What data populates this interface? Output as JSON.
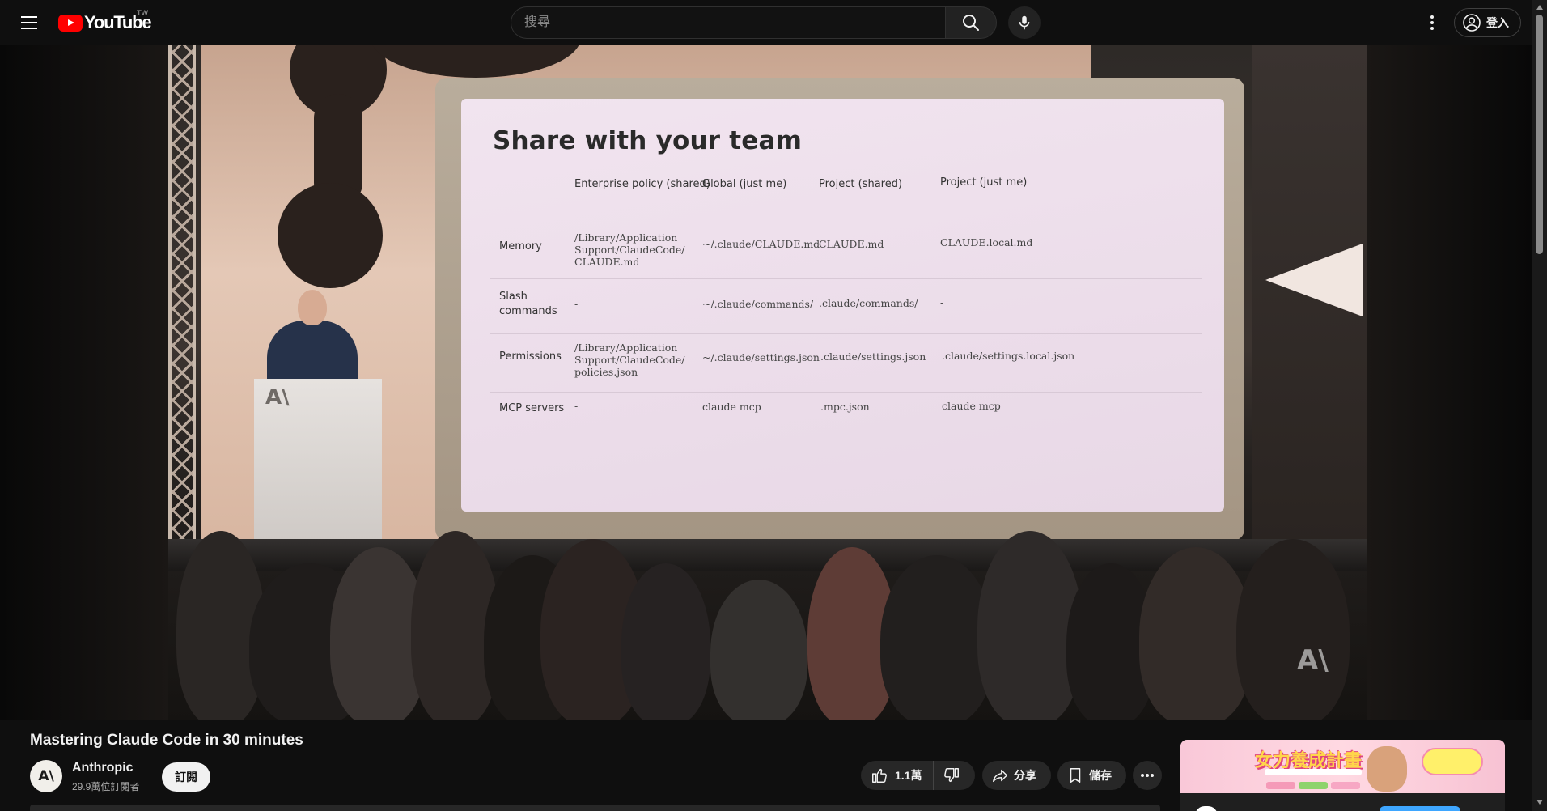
{
  "header": {
    "logo_text": "YouTube",
    "region_code": "TW",
    "search_placeholder": "搜尋",
    "signin_label": "登入"
  },
  "slide": {
    "title": "Share with your team",
    "columns": [
      "Enterprise policy (shared)",
      "Global (just me)",
      "Project (shared)",
      "Project (just me)"
    ],
    "rows": [
      {
        "label": "Memory",
        "cells": [
          "/Library/Application\nSupport/ClaudeCode/\nCLAUDE.md",
          "~/.claude/CLAUDE.md",
          "CLAUDE.md",
          "CLAUDE.local.md"
        ]
      },
      {
        "label": "Slash\ncommands",
        "cells": [
          "-",
          "~/.claude/commands/",
          ".claude/commands/",
          "-"
        ]
      },
      {
        "label": "Permissions",
        "cells": [
          "/Library/Application\nSupport/ClaudeCode/\npolicies.json",
          "~/.claude/settings.json",
          ".claude/settings.json",
          ".claude/settings.local.json"
        ]
      },
      {
        "label": "MCP servers",
        "cells": [
          "-",
          "claude mcp",
          ".mpc.json",
          "claude mcp"
        ]
      }
    ],
    "podium_logo": "A\\",
    "watermark_logo": "A\\"
  },
  "video": {
    "title": "Mastering Claude Code in 30 minutes"
  },
  "channel": {
    "avatar_text": "A\\",
    "name": "Anthropic",
    "subscribers": "29.9萬位訂閱者",
    "subscribe_label": "訂閱"
  },
  "actions": {
    "like_count": "1.1萬",
    "share_label": "分享",
    "save_label": "儲存"
  },
  "ad": {
    "headline": "女力養成計畫"
  },
  "colors": {
    "background": "#0f0f0f",
    "brand_red": "#ff0000",
    "pill": "#272727",
    "link_blue": "#3ea6ff"
  }
}
